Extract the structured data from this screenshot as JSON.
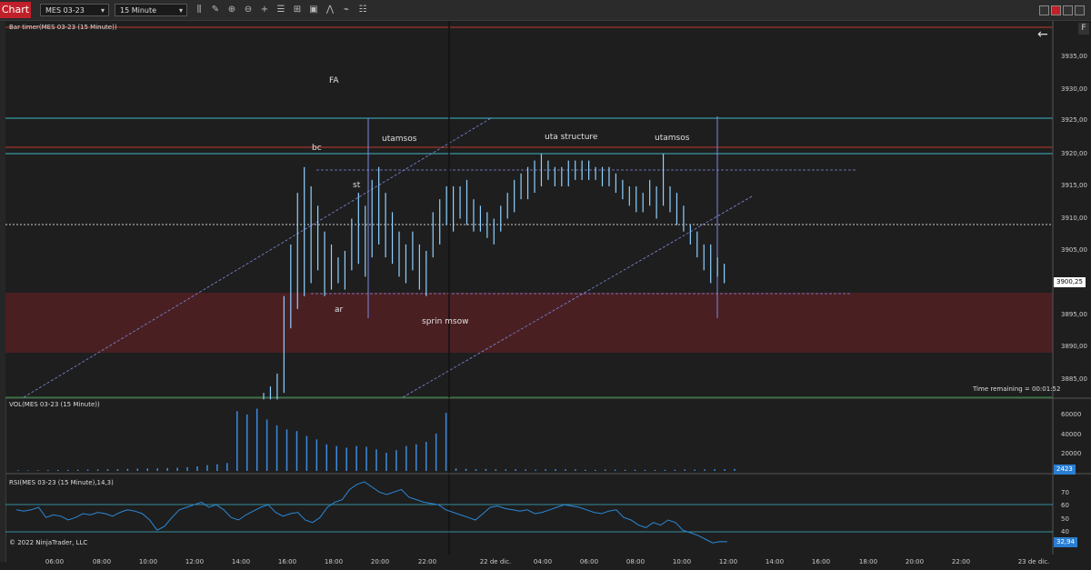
{
  "toolbar": {
    "chart_tab": "Chart",
    "instrument": "MES 03-23",
    "interval": "15 Minute"
  },
  "price_panel": {
    "label": "Bar timer(MES 03-23 (15 Minute))",
    "time_remaining": "Time remaining = 00:01:52",
    "last_price": "3900,25",
    "y_ticks": [
      "3935,00",
      "3930,00",
      "3925,00",
      "3920,00",
      "3915,00",
      "3910,00",
      "3905,00",
      "3895,00",
      "3890,00",
      "3885,00"
    ],
    "annotations": {
      "fa": "FA",
      "bc": "bc",
      "st": "st",
      "ar": "ar",
      "utamsos_1": "utamsos",
      "uta_structure": "uta structure",
      "utamsos_2": "utamsos",
      "sprin_msow": "sprin msow"
    }
  },
  "volume_panel": {
    "label": "VOL(MES 03-23 (15 Minute))",
    "last_value": "2423",
    "y_ticks": [
      "60000",
      "40000",
      "20000"
    ]
  },
  "rsi_panel": {
    "label": "RSI(MES 03-23 (15 Minute),14,3)",
    "last_value": "32,94",
    "y_ticks": [
      "70",
      "60",
      "50",
      "40",
      "30"
    ]
  },
  "x_ticks": [
    "06:00",
    "08:00",
    "10:00",
    "12:00",
    "14:00",
    "16:00",
    "18:00",
    "20:00",
    "22:00",
    "22 de dic.",
    "04:00",
    "06:00",
    "08:00",
    "10:00",
    "12:00",
    "14:00",
    "16:00",
    "18:00",
    "20:00",
    "22:00",
    "23 de dic."
  ],
  "copyright": "© 2022 NinjaTrader, LLC",
  "colors": {
    "background": "#1e1e1e",
    "bars": "#8fd0ff",
    "volume": "#3d8be0",
    "rsi": "#2a88d8",
    "cyan_lines": "#3fb6c8",
    "red_line": "#c0392b",
    "zone": "#4a1f22"
  },
  "chart_data": {
    "type": "candlestick",
    "price_series_ohlc_range_y": [
      3882,
      3938
    ],
    "price_bars": [
      [
        3882,
        3883
      ],
      [
        3882,
        3884
      ],
      [
        3882,
        3886
      ],
      [
        3883,
        3898
      ],
      [
        3893,
        3906
      ],
      [
        3896,
        3914
      ],
      [
        3898,
        3918
      ],
      [
        3900,
        3915
      ],
      [
        3902,
        3912
      ],
      [
        3898,
        3908
      ],
      [
        3899,
        3906
      ],
      [
        3900,
        3904
      ],
      [
        3899,
        3905
      ],
      [
        3902,
        3910
      ],
      [
        3903,
        3914
      ],
      [
        3901,
        3912
      ],
      [
        3904,
        3916
      ],
      [
        3906,
        3918
      ],
      [
        3904,
        3914
      ],
      [
        3903,
        3911
      ],
      [
        3901,
        3908
      ],
      [
        3900,
        3906
      ],
      [
        3902,
        3908
      ],
      [
        3899,
        3906
      ],
      [
        3898,
        3905
      ],
      [
        3904,
        3911
      ],
      [
        3906,
        3913
      ],
      [
        3909,
        3915
      ],
      [
        3908,
        3915
      ],
      [
        3910,
        3915
      ],
      [
        3909,
        3916
      ],
      [
        3908,
        3913
      ],
      [
        3908,
        3912
      ],
      [
        3907,
        3911
      ],
      [
        3906,
        3910
      ],
      [
        3908,
        3912
      ],
      [
        3910,
        3914
      ],
      [
        3911,
        3916
      ],
      [
        3913,
        3917
      ],
      [
        3913,
        3918
      ],
      [
        3914,
        3919
      ],
      [
        3915,
        3920
      ],
      [
        3916,
        3919
      ],
      [
        3915,
        3918
      ],
      [
        3915,
        3918
      ],
      [
        3915,
        3919
      ],
      [
        3916,
        3919
      ],
      [
        3916,
        3919
      ],
      [
        3916,
        3919
      ],
      [
        3916,
        3918
      ],
      [
        3915,
        3918
      ],
      [
        3915,
        3918
      ],
      [
        3914,
        3917
      ],
      [
        3913,
        3916
      ],
      [
        3912,
        3915
      ],
      [
        3911,
        3915
      ],
      [
        3911,
        3914
      ],
      [
        3912,
        3916
      ],
      [
        3910,
        3915
      ],
      [
        3912,
        3920
      ],
      [
        3911,
        3915
      ],
      [
        3909,
        3914
      ],
      [
        3908,
        3912
      ],
      [
        3906,
        3909
      ],
      [
        3904,
        3908
      ],
      [
        3902,
        3906
      ],
      [
        3900,
        3906
      ],
      [
        3901,
        3904
      ],
      [
        3900,
        3903
      ]
    ],
    "volume_values": [
      800,
      700,
      900,
      1000,
      1200,
      1300,
      1500,
      1600,
      1800,
      2000,
      2200,
      2500,
      2800,
      3000,
      3200,
      3500,
      3800,
      4500,
      5500,
      7000,
      8000,
      9500,
      72000,
      68000,
      75000,
      62000,
      55000,
      50000,
      48000,
      42000,
      38000,
      32000,
      30000,
      28000,
      30000,
      29000,
      26000,
      22000,
      25000,
      30000,
      32000,
      35000,
      45000,
      70000,
      3000,
      2500,
      2000,
      2300,
      2000,
      1800,
      2100,
      1700,
      1500,
      1900,
      2200,
      2000,
      1800,
      1500,
      1300,
      1700,
      1600,
      1400,
      1500,
      1300,
      1200,
      1400,
      1500,
      1700,
      1600,
      1800,
      2000,
      2100,
      2423
    ],
    "rsi_values": [
      58,
      57,
      58,
      60,
      52,
      54,
      53,
      50,
      52,
      55,
      54,
      56,
      55,
      53,
      56,
      58,
      57,
      55,
      50,
      42,
      45,
      52,
      58,
      60,
      62,
      64,
      60,
      62,
      58,
      52,
      50,
      54,
      57,
      60,
      62,
      56,
      53,
      55,
      56,
      50,
      48,
      52,
      60,
      64,
      66,
      74,
      78,
      80,
      76,
      72,
      70,
      72,
      74,
      68,
      66,
      64,
      63,
      62,
      58,
      56,
      54,
      52,
      50,
      55,
      60,
      61,
      59,
      58,
      57,
      58,
      55,
      56,
      58,
      60,
      62,
      61,
      60,
      58,
      56,
      55,
      57,
      58,
      52,
      50,
      46,
      44,
      48,
      46,
      50,
      48,
      42,
      40,
      38,
      35,
      32,
      33,
      32.94
    ],
    "y_ticks_price": [
      3885,
      3890,
      3895,
      3905,
      3910,
      3915,
      3920,
      3925,
      3930,
      3935
    ],
    "rsi_ylim": [
      30,
      80
    ],
    "volume_ylim": [
      0,
      80000
    ]
  }
}
